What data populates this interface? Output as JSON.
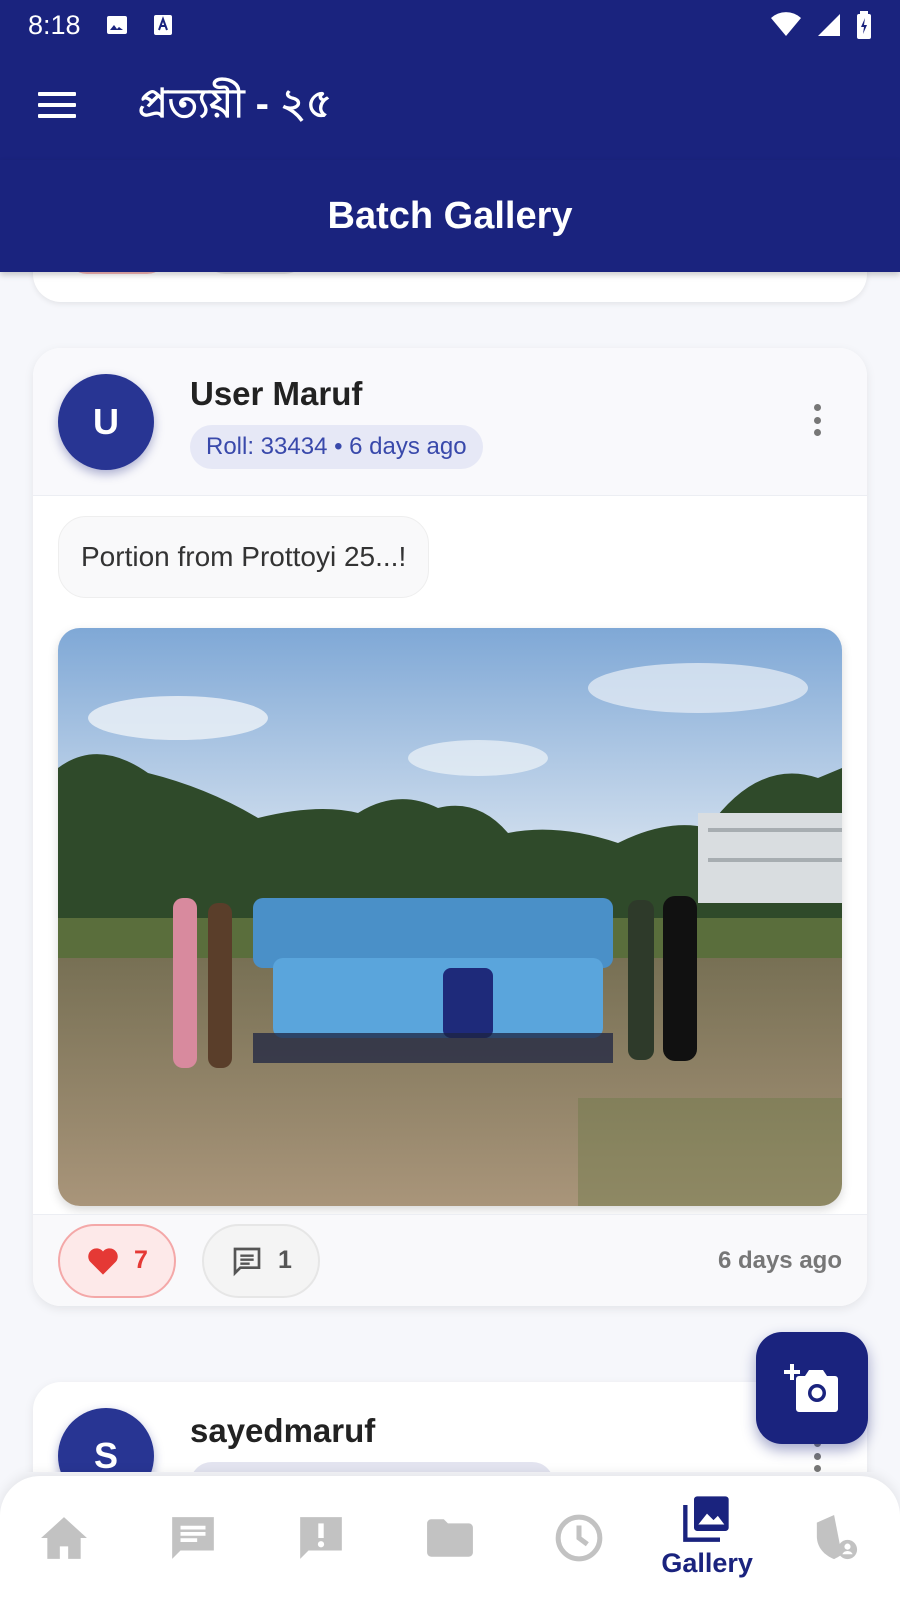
{
  "status_bar": {
    "time": "8:18",
    "icons_left": [
      "image-icon",
      "text-notification-icon"
    ],
    "icons_right": [
      "wifi-icon",
      "signal-icon",
      "battery-icon"
    ]
  },
  "app_bar": {
    "title": "প্রত্যয়ী - ২৫",
    "menu_icon": "hamburger-menu-icon"
  },
  "page_header": {
    "title": "Batch Gallery"
  },
  "colors": {
    "primary": "#1a237e",
    "accent_like": "#e53935",
    "pill_bg": "#e6e8f6"
  },
  "posts": [
    {
      "avatar_initial": "U",
      "user_name": "User Maruf",
      "meta": "Roll: 33434 • 6 days ago",
      "caption": "Portion from Prottoyi 25...!",
      "likes": "7",
      "comments": "1",
      "time": "6 days ago"
    },
    {
      "avatar_initial": "S",
      "user_name": "sayedmaruf"
    }
  ],
  "fab": {
    "icon": "add-photo-icon"
  },
  "bottom_nav": {
    "items": [
      {
        "icon": "home-icon",
        "label": ""
      },
      {
        "icon": "chat-icon",
        "label": ""
      },
      {
        "icon": "alert-icon",
        "label": ""
      },
      {
        "icon": "folder-icon",
        "label": ""
      },
      {
        "icon": "clock-icon",
        "label": ""
      },
      {
        "icon": "gallery-icon",
        "label": "Gallery",
        "active": true
      },
      {
        "icon": "admin-shield-icon",
        "label": ""
      }
    ]
  }
}
